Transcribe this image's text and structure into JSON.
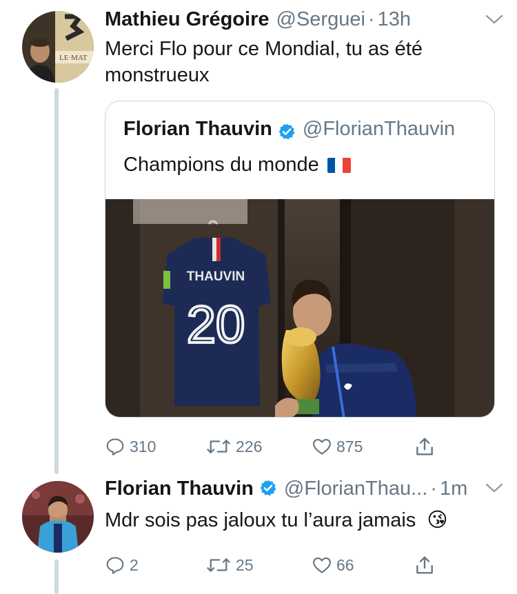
{
  "tweets": [
    {
      "author_name": "Mathieu Grégoire",
      "author_handle": "@Serguei",
      "separator": "·",
      "time": "13h",
      "text": "Merci Flo pour ce Mondial, tu as été monstrueux",
      "avatar_sign_text": "LE·MAT",
      "quoted": {
        "author_name": "Florian Thauvin",
        "author_handle": "@FlorianThauvin",
        "verified": true,
        "text": "Champions du monde",
        "photo": {
          "jersey_name": "THAUVIN",
          "jersey_number": "20"
        }
      },
      "actions": {
        "replies": "310",
        "retweets": "226",
        "likes": "875"
      }
    },
    {
      "author_name": "Florian Thauvin",
      "author_handle": "@FlorianThau...",
      "verified": true,
      "separator": "·",
      "time": "1m",
      "text": "Mdr sois pas jaloux tu l’aura jamais",
      "emoji": "😘",
      "actions": {
        "replies": "2",
        "retweets": "25",
        "likes": "66"
      }
    }
  ],
  "icons": {
    "reply": "reply-icon",
    "retweet": "retweet-icon",
    "like": "heart-icon",
    "share": "share-icon",
    "verified": "verified-badge-icon",
    "more": "chevron-down-icon"
  },
  "colors": {
    "name": "#14171a",
    "secondary": "#657786",
    "verified": "#1da1f2",
    "thread_line": "#cfd9de",
    "border": "#ccd6dd",
    "flag_blue": "#0055a4",
    "flag_white": "#ffffff",
    "flag_red": "#ef4135"
  }
}
